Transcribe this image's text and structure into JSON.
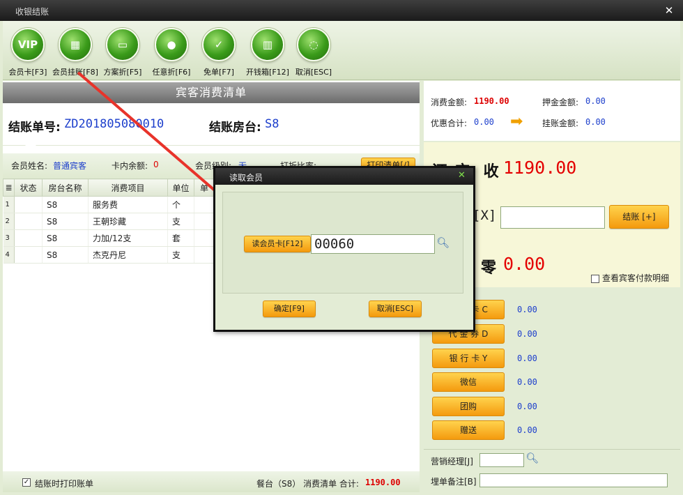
{
  "window": {
    "title": "收银结账"
  },
  "toolbar": [
    {
      "icon": "vip-card-icon",
      "glyph": "VIP",
      "label": "会员卡[F3]"
    },
    {
      "icon": "member-charge-icon",
      "glyph": "▦",
      "label": "会员挂账[F8]"
    },
    {
      "icon": "plan-discount-icon",
      "glyph": "▭",
      "label": "方案折[F5]"
    },
    {
      "icon": "any-discount-icon",
      "glyph": "●",
      "label": "任意折[F6]"
    },
    {
      "icon": "free-order-icon",
      "glyph": "✓",
      "label": "免单[F7]"
    },
    {
      "icon": "cash-drawer-icon",
      "glyph": "▥",
      "label": "开钱箱[F12]"
    },
    {
      "icon": "cancel-icon",
      "glyph": "◌",
      "label": "取消[ESC]"
    }
  ],
  "bill": {
    "header": "宾客消费清单",
    "number_label": "结账单号:",
    "number": "ZD201805080010",
    "table_label": "结账房台:",
    "table": "S8"
  },
  "member": {
    "name_label": "会员姓名:",
    "name": "普通宾客",
    "balance_label": "卡内余额:",
    "balance": "0",
    "level_label": "会员级别:",
    "level": "无",
    "discount_label": "打折比率:",
    "print_button": "打印清单[/]"
  },
  "grid": {
    "columns": [
      "状态",
      "房台名称",
      "消费项目",
      "单位",
      "单"
    ],
    "rows": [
      {
        "n": "1",
        "status": "",
        "room": "S8",
        "item": "服务费",
        "unit": "个"
      },
      {
        "n": "2",
        "status": "",
        "room": "S8",
        "item": "王朝珍藏",
        "unit": "支"
      },
      {
        "n": "3",
        "status": "",
        "room": "S8",
        "item": "力加/12支",
        "unit": "套"
      },
      {
        "n": "4",
        "status": "",
        "room": "S8",
        "item": "杰克丹尼",
        "unit": "支"
      }
    ]
  },
  "footer": {
    "print_on_checkout_checked": true,
    "print_on_checkout_label": "结账时打印账单",
    "summary_prefix": "餐台（S8） 消费清单 合计:",
    "summary_total": "1190.00"
  },
  "totals": {
    "consume_label": "消费金额:",
    "consume": "1190.00",
    "deposit_label": "押金金额:",
    "deposit": "0.00",
    "discount_label": "优惠合计:",
    "discount": "0.00",
    "credit_label": "挂账金额:",
    "credit": "0.00"
  },
  "payment": {
    "receivable_label": "应 收",
    "receivable_prefix": "还",
    "receivable": "1190.00",
    "cash_key": "[X]",
    "checkout_button": "结账 [+]",
    "change_label": "零",
    "change": "0.00",
    "view_detail_label": "查看宾客付款明细",
    "methods": [
      {
        "label": "储 值 卡 C",
        "amount": "0.00"
      },
      {
        "label": "代 金 券 D",
        "amount": "0.00"
      },
      {
        "label": "银 行 卡 Y",
        "amount": "0.00"
      },
      {
        "label": "微信",
        "amount": "0.00"
      },
      {
        "label": "团购",
        "amount": "0.00"
      },
      {
        "label": "赠送",
        "amount": "0.00"
      }
    ],
    "manager_label": "营销经理[J]",
    "note_label": "埋单备注[B]"
  },
  "dialog": {
    "title": "读取会员",
    "read_card_button": "读会员卡[F12]",
    "card_number": "00060",
    "ok_button": "确定[F9]",
    "cancel_button": "取消[ESC]"
  },
  "colors": {
    "accent_orange": "#f49a0e",
    "amount_red": "#e40000",
    "value_blue": "#1d3fcc",
    "arrow_red": "#e8332a"
  }
}
